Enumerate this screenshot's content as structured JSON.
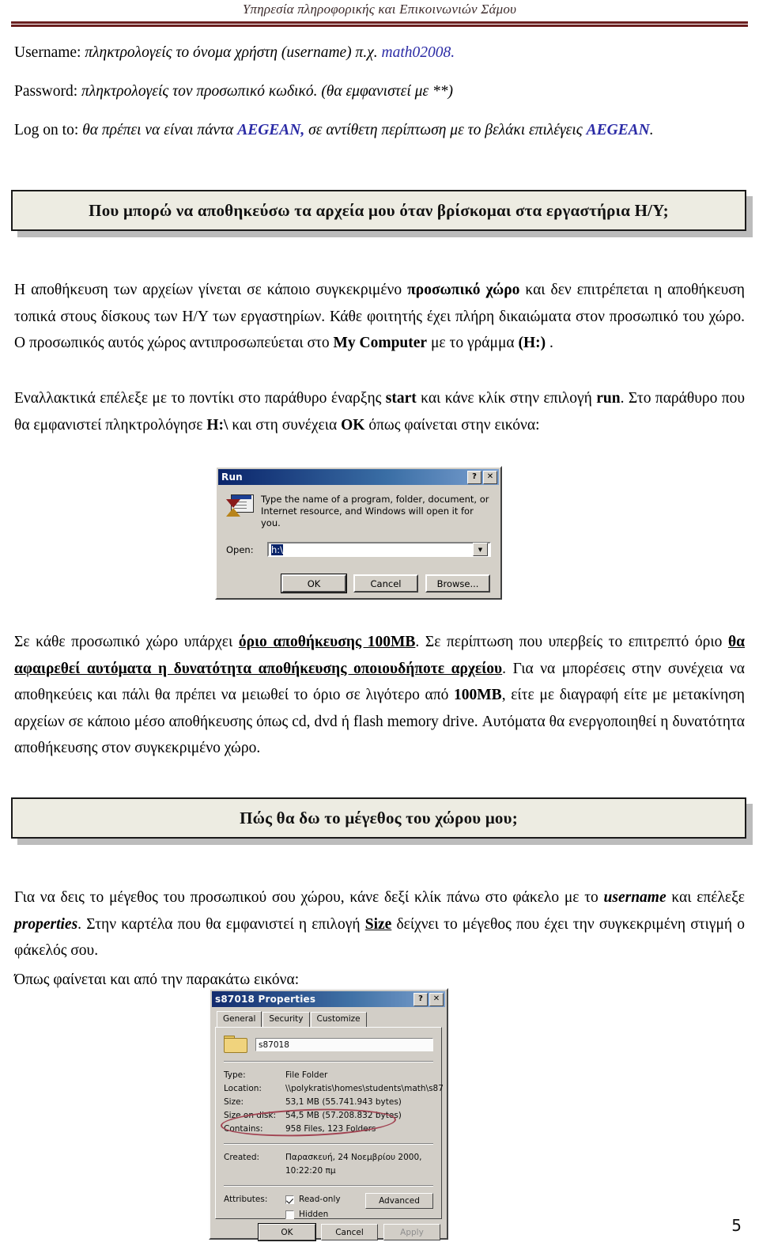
{
  "header": {
    "title": "Υπηρεσία πληροφορικής και Επικοινωνιών Σάμου"
  },
  "intro": {
    "username_label": "Username:",
    "username_text": " πληκτρολογείς το όνομα χρήστη (username) π.χ. ",
    "username_example": "math02008.",
    "password_label": "Password:",
    "password_text": " πληκτρολογείς τον προσωπικό κωδικό. (θα εμφανιστεί με **)",
    "logon_label": "Log on to:",
    "logon_text1": " θα πρέπει να είναι πάντα ",
    "logon_domain1": "AEGEAN,",
    "logon_text2": " σε αντίθετη περίπτωση με το βελάκι επιλέγεις ",
    "logon_domain2": "AEGEAN",
    "logon_end": "."
  },
  "section1": {
    "heading": "Που μπορώ να αποθηκεύσω τα αρχεία μου όταν βρίσκομαι στα εργαστήρια Η/Υ;",
    "p1_a": "Η αποθήκευση των αρχείων γίνεται σε κάποιο συγκεκριμένο ",
    "p1_b_personal": "προσωπικό χώρο",
    "p1_c": " και δεν επιτρέπεται  η αποθήκευση τοπικά στους δίσκους των Η/Υ των εργαστηρίων. Κάθε φοιτητής έχει πλήρη δικαιώματα στον προσωπικό του χώρο.  Ο προσωπικός αυτός χώρος αντιπροσωπεύεται στο ",
    "p1_d_mycomputer": "My Computer",
    "p1_e": " με το γράμμα ",
    "p1_f_drive": "(H:)",
    "p1_g": " .",
    "p2_a": "Εναλλακτικά επέλεξε με το ποντίκι στο παράθυρο έναρξης ",
    "p2_b_start": "start",
    "p2_c": " και κάνε κλίκ στην επιλογή ",
    "p2_d_run": "run",
    "p2_e": ". Στο παράθυρο που θα εμφανιστεί πληκτρολόγησε ",
    "p2_f_path": "H:\\",
    "p2_g": "  και στη συνέχεια ",
    "p2_h_ok": "OK",
    "p2_i": " όπως φαίνεται στην εικόνα:",
    "p3_a": "Σε κάθε προσωπικό χώρο υπάρχει ",
    "p3_b_limit": "όριο αποθήκευσης 100MB",
    "p3_c": ". Σε περίπτωση που  υπερβείς το επιτρεπτό όριο ",
    "p3_d_warn": "θα αφαιρεθεί αυτόματα η δυνατότητα αποθήκευσης οποιουδήποτε αρχείου",
    "p3_e": ". Για να μπορέσεις στην συνέχεια  να αποθηκεύεις  και πάλι θα πρέπει να μειωθεί το όριο σε λιγότερο από ",
    "p3_f_limit2": "100MB",
    "p3_g": ", είτε με διαγραφή είτε με μετακίνηση αρχείων σε κάποιο μέσο αποθήκευσης όπως cd, dvd ή flash memory drive. Αυτόματα θα ενεργοποιηθεί η δυνατότητα αποθήκευσης στον συγκεκριμένο χώρο."
  },
  "section2": {
    "heading": "Πώς θα δω το μέγεθος του χώρου μου;",
    "p1_a": "Για να δεις το μέγεθος του  προσωπικού  σου χώρου, κάνε δεξί κλίκ πάνω στο φάκελο με το ",
    "p1_b_username": "username",
    "p1_c": " και επέλεξε ",
    "p1_d_properties": "properties",
    "p1_e": ". Στην καρτέλα που θα εμφανιστεί η επιλογή ",
    "p1_f_size": "Size",
    "p1_g": " δείχνει το μέγεθος που έχει την συγκεκριμένη στιγμή ο φάκελός σου.",
    "p2": "Όπως φαίνεται και από την παρακάτω εικόνα:"
  },
  "run_dialog": {
    "title": "Run",
    "help_button": "?",
    "close_button": "✕",
    "description": "Type the name of a program, folder, document, or Internet resource, and Windows will open it for you.",
    "open_label": "Open:",
    "open_value": "h:\\",
    "dropdown_arrow": "▼",
    "ok_label": "OK",
    "cancel_label": "Cancel",
    "browse_label": "Browse..."
  },
  "props_dialog": {
    "title": "s87018 Properties",
    "help_button": "?",
    "close_button": "✕",
    "tabs": [
      {
        "label": "General",
        "active": true
      },
      {
        "label": "Security",
        "active": false
      },
      {
        "label": "Customize",
        "active": false
      }
    ],
    "folder_name": "s87018",
    "rows": [
      {
        "key": "Type:",
        "value": "File Folder"
      },
      {
        "key": "Location:",
        "value": "\\\\polykratis\\homes\\students\\math\\s87"
      },
      {
        "key": "Size:",
        "value": "53,1 MB (55.741.943 bytes)"
      },
      {
        "key": "Size on disk:",
        "value": "54,5 MB (57.208.832 bytes)"
      },
      {
        "key": "Contains:",
        "value": "958 Files, 123 Folders"
      }
    ],
    "created_key": "Created:",
    "created_value": "Παρασκευή, 24 Νοεμβρίου 2000, 10:22:20 πμ",
    "attributes_key": "Attributes:",
    "readonly_label": "Read-only",
    "hidden_label": "Hidden",
    "advanced_label": "Advanced",
    "ok_label": "OK",
    "cancel_label": "Cancel",
    "apply_label": "Apply"
  },
  "footer": {
    "page_number": "5"
  },
  "colors": {
    "header_rule": "#6b1f1f",
    "link_blue": "#2a2aa5",
    "heading_box_bg": "#edece2",
    "titlebar_blue": "#0a246a",
    "dialog_face": "#d4d0c8",
    "highlight_ellipse": "#a03c4c"
  }
}
